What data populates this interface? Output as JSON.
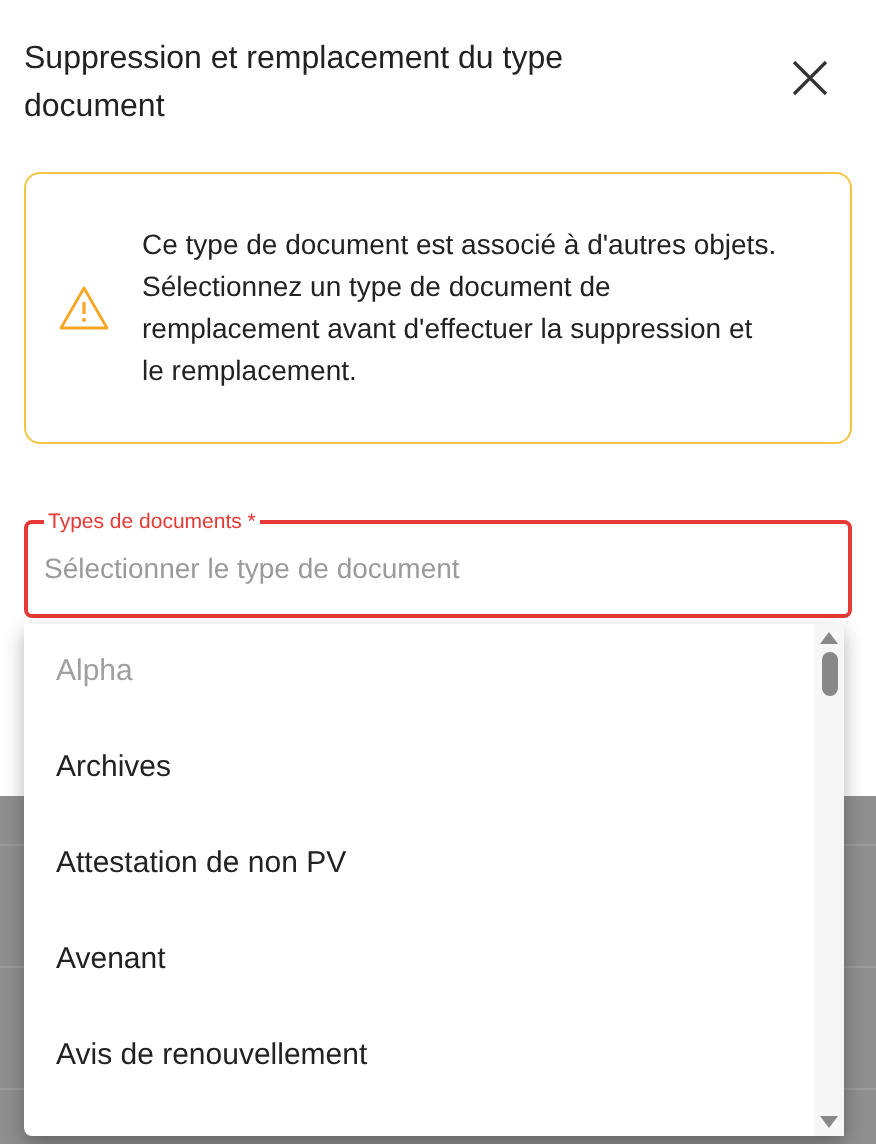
{
  "dialog": {
    "title": "Suppression et remplacement du type document"
  },
  "warning": {
    "message": "Ce type de document est associé à d'autres objets. Sélectionnez un type de document de remplacement avant d'effectuer la suppression et le remplacement."
  },
  "field": {
    "label": "Types de documents *",
    "placeholder": "Sélectionner le type de document",
    "error": true
  },
  "options": [
    {
      "label": "Alpha",
      "disabled": true
    },
    {
      "label": "Archives",
      "disabled": false
    },
    {
      "label": "Attestation de non PV",
      "disabled": false
    },
    {
      "label": "Avenant",
      "disabled": false
    },
    {
      "label": "Avis de renouvellement",
      "disabled": false
    }
  ]
}
